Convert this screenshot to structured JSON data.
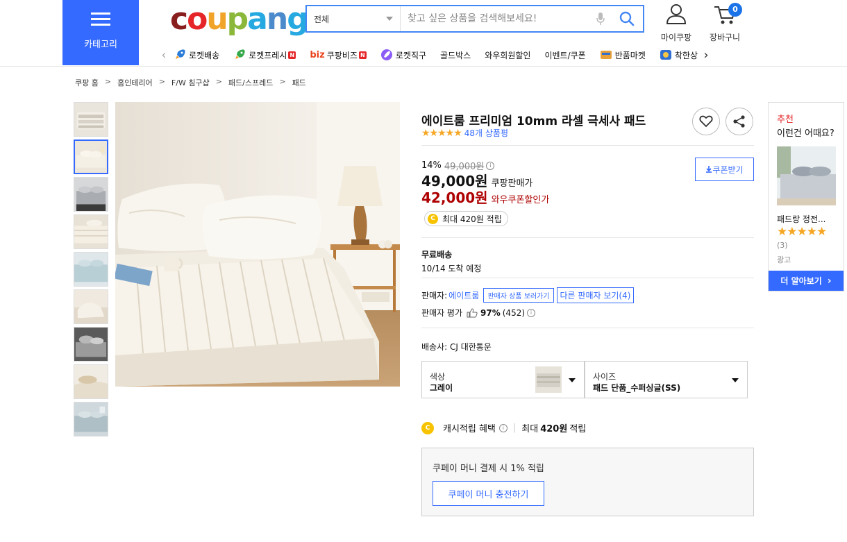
{
  "header": {
    "category_label": "카테고리",
    "logo_text": "coupang",
    "search": {
      "scope": "전체",
      "placeholder": "찾고 싶은 상품을 검색해보세요!"
    },
    "mycoupang_label": "마이쿠팡",
    "cart_label": "장바구니",
    "cart_count": "0",
    "nav_items": [
      {
        "label": "로켓배송",
        "icon": "rocket-icon",
        "badge": ""
      },
      {
        "label": "로켓프레시",
        "icon": "rocket-fresh-icon",
        "badge": "N"
      },
      {
        "label": "쿠팡비즈",
        "icon": "biz-icon",
        "badge": "N"
      },
      {
        "label": "로켓직구",
        "icon": "rocket-global-icon",
        "badge": ""
      },
      {
        "label": "골드박스",
        "icon": "",
        "badge": ""
      },
      {
        "label": "와우회원할인",
        "icon": "",
        "badge": ""
      },
      {
        "label": "이벤트/쿠폰",
        "icon": "",
        "badge": ""
      },
      {
        "label": "반품마켓",
        "icon": "return-market-icon",
        "badge": ""
      },
      {
        "label": "착한상",
        "icon": "good-store-icon",
        "badge": ""
      }
    ],
    "biz_prefix": "biz"
  },
  "breadcrumb": [
    "쿠팡 홈",
    "홈인테리어",
    "F/W 침구샵",
    "패드/스프레드",
    "패드"
  ],
  "product": {
    "title": "에이트룸 프리미엄 10mm 라셀 극세사 패드",
    "stars": "★★★★★",
    "review_count": "48개 상품평",
    "discount_rate": "14%",
    "original_price": "49,000원",
    "sale_price": "49,000원",
    "sale_price_label": "쿠팡판매가",
    "wow_price": "42,000원",
    "wow_price_label": "와우쿠폰할인가",
    "coupon_button": "쿠폰받기",
    "cash_max": "최대 420원 적립",
    "shipping_title": "무료배송",
    "shipping_date": "10/14 도착 예정",
    "seller_prefix": "판매자:",
    "seller_name": "에이트룸",
    "seller_tooltip": "판매자 상품 보러가기",
    "other_sellers": "다른 판매자 보기(4)",
    "seller_rating_label": "판매자 평가",
    "seller_rating_pct": "97%",
    "seller_rating_count": "(452)",
    "delivery_company": "배송사: CJ 대한통운",
    "options": {
      "color_label": "색상",
      "color_value": "그레이",
      "size_label": "사이즈",
      "size_value": "패드 단품_수퍼싱글(SS)"
    },
    "cash_benefit_label": "캐시적립 혜택",
    "cash_benefit_max_prefix": "최대",
    "cash_benefit_amount": "420원",
    "cash_benefit_suffix": "적립",
    "coupay_text": "쿠페이 머니 결제 시 1% 적립",
    "coupay_button": "쿠페이 머니 충전하기"
  },
  "recommend": {
    "title1": "추천",
    "title2": "이런건 어때요?",
    "item_name": "패드랑 정전...",
    "item_stars": "★★★★★",
    "item_count": "(3)",
    "ad_label": "광고",
    "more_button": "더 알아보기"
  },
  "colors": {
    "accent": "#346aff",
    "wow_red": "#ae0000",
    "star": "#f5a623"
  }
}
